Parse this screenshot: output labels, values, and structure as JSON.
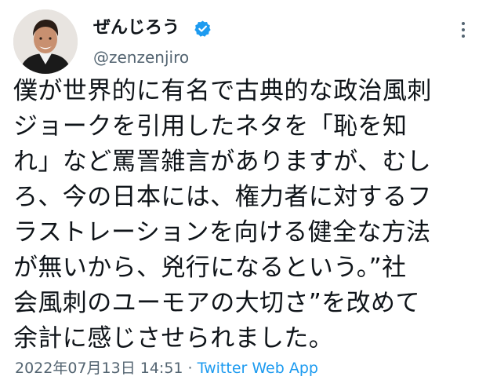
{
  "tweet": {
    "display_name": "ぜんじろう",
    "handle": "@zenzenjiro",
    "text": "僕が世界的に有名で古典的な政治風刺\nジョークを引用したネタを「恥を知\nれ」など罵詈雑言がありますが、むし\nろ、今の日本には、権力者に対するフ\nラストレーションを向ける健全な方法\nが無いから、兇行になるという。”社\n会風刺のユーモアの大切さ”を改めて\n余計に感じさせられました。",
    "timestamp": "2022年07月13日 14:51",
    "separator": " · ",
    "source": "Twitter Web App"
  },
  "icons": {
    "avatar": "profile-photo",
    "verified": "verified-badge-icon",
    "more": "more-options-icon"
  },
  "colors": {
    "text": "#0f1419",
    "secondary": "#536471",
    "accent": "#1d9bf0"
  }
}
